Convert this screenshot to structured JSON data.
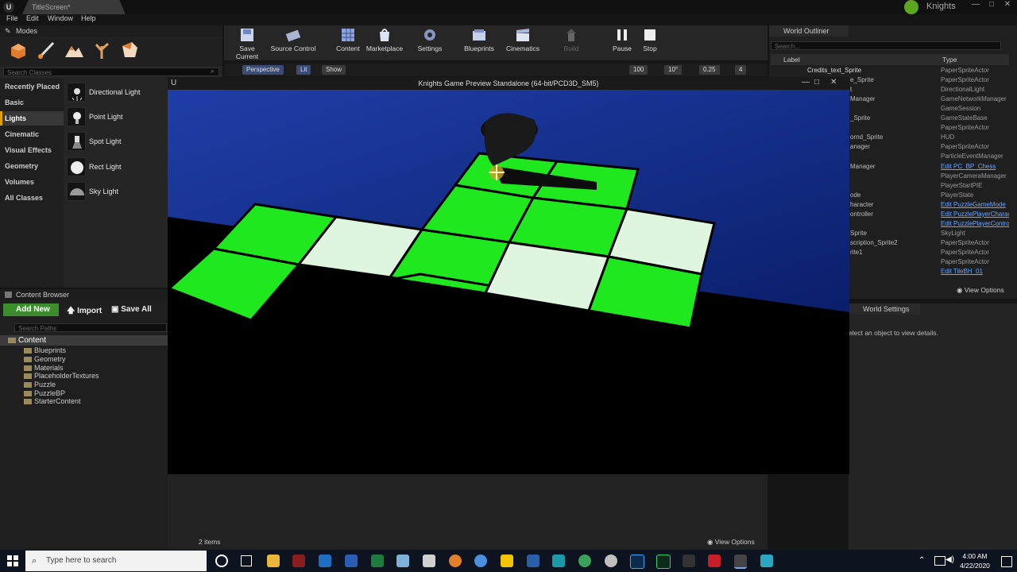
{
  "titlebar": {
    "tab": "TitleScreen*",
    "project": "Knights"
  },
  "menu": [
    "File",
    "Edit",
    "Window",
    "Help"
  ],
  "modes": {
    "title": "Modes",
    "search_placeholder": "Search Classes",
    "categories": [
      "Recently Placed",
      "Basic",
      "Lights",
      "Cinematic",
      "Visual Effects",
      "Geometry",
      "Volumes",
      "All Classes"
    ],
    "items": [
      "Directional Light",
      "Point Light",
      "Spot Light",
      "Rect Light",
      "Sky Light"
    ]
  },
  "toolbar": [
    "Save Current",
    "Source Control",
    "Content",
    "Marketplace",
    "Settings",
    "Blueprints",
    "Cinematics",
    "Build",
    "Pause",
    "Stop"
  ],
  "viewport": {
    "perspective": "Perspective",
    "lit": "Lit",
    "show": "Show",
    "snap_values": [
      "100",
      "10°",
      "0.25",
      "4"
    ]
  },
  "game_window": {
    "title": "Knights Game Preview Standalone (64-bit/PCD3D_SM5)"
  },
  "outliner": {
    "title": "World Outliner",
    "search_placeholder": "Search...",
    "col_label": "Label",
    "col_type": "Type",
    "first_label": "Credits_text_Sprite",
    "labels": [
      "e_Sprite",
      "t",
      "Manager",
      "",
      "_Sprite",
      "",
      "ornd_Sprite",
      "anager",
      "",
      "Manager",
      "",
      "",
      "ode",
      "haracter",
      "ontroller",
      "",
      "Sprite",
      "scription_Sprite2",
      "rite1"
    ],
    "types": [
      {
        "t": "PaperSpriteActor",
        "link": false
      },
      {
        "t": "PaperSpriteActor",
        "link": false
      },
      {
        "t": "DirectionalLight",
        "link": false
      },
      {
        "t": "GameNetworkManager",
        "link": false
      },
      {
        "t": "GameSession",
        "link": false
      },
      {
        "t": "GameStateBase",
        "link": false
      },
      {
        "t": "PaperSpriteActor",
        "link": false
      },
      {
        "t": "HUD",
        "link": false
      },
      {
        "t": "PaperSpriteActor",
        "link": false
      },
      {
        "t": "ParticleEventManager",
        "link": false
      },
      {
        "t": "Edit PC_BP_Chess",
        "link": true
      },
      {
        "t": "PlayerCameraManager",
        "link": false
      },
      {
        "t": "PlayerStartPIE",
        "link": false
      },
      {
        "t": "PlayerState",
        "link": false
      },
      {
        "t": "Edit PuzzleGameMode",
        "link": true
      },
      {
        "t": "Edit PuzzlePlayerCharacter",
        "link": true
      },
      {
        "t": "Edit PuzzlePlayerController",
        "link": true
      },
      {
        "t": "SkyLight",
        "link": false
      },
      {
        "t": "PaperSpriteActor",
        "link": false
      },
      {
        "t": "PaperSpriteActor",
        "link": false
      },
      {
        "t": "PaperSpriteActor",
        "link": false
      },
      {
        "t": "Edit TileBH_01",
        "link": true
      }
    ],
    "view_options": "View Options"
  },
  "details": {
    "tab": "World Settings",
    "empty_text": "elect an object to view details."
  },
  "content_browser": {
    "title": "Content Browser",
    "add_new": "Add New",
    "import": "Import",
    "save_all": "Save All",
    "search_placeholder": "Search Paths",
    "root": "Content",
    "folders": [
      "Blueprints",
      "Geometry",
      "Materials",
      "PlaceholderTextures",
      "Puzzle",
      "PuzzleBP",
      "StarterContent"
    ],
    "item_count": "2 items",
    "view_options": "View Options"
  },
  "taskbar": {
    "search_placeholder": "Type here to search",
    "time": "4:00 AM",
    "date": "4/22/2020"
  }
}
